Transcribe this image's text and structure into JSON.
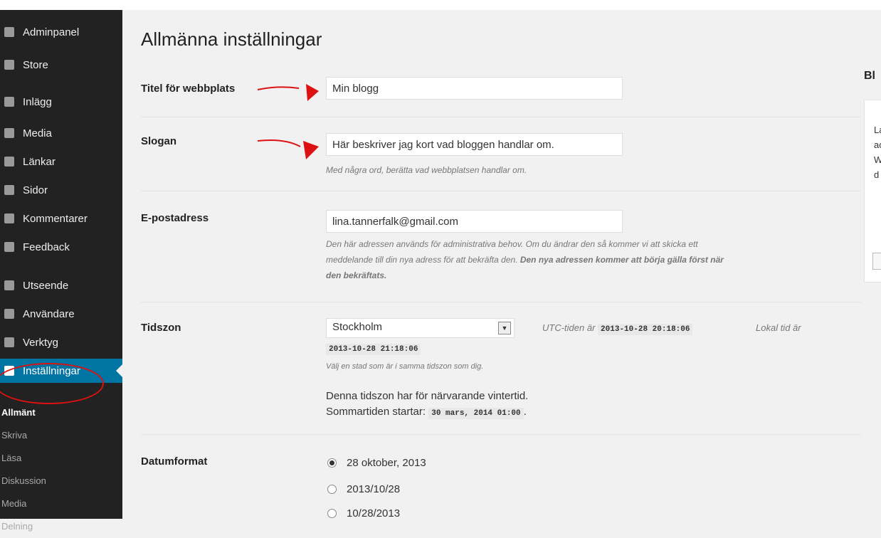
{
  "sidebar": {
    "items": [
      {
        "label": "Adminpanel"
      },
      {
        "label": "Store"
      },
      {
        "label": "Inlägg"
      },
      {
        "label": "Media"
      },
      {
        "label": "Länkar"
      },
      {
        "label": "Sidor"
      },
      {
        "label": "Kommentarer"
      },
      {
        "label": "Feedback"
      },
      {
        "label": "Utseende"
      },
      {
        "label": "Användare"
      },
      {
        "label": "Verktyg"
      },
      {
        "label": "Inställningar"
      }
    ],
    "submenu": [
      "Allmänt",
      "Skriva",
      "Läsa",
      "Diskussion",
      "Media",
      "Delning"
    ]
  },
  "page": {
    "title": "Allmänna inställningar"
  },
  "title_row": {
    "label": "Titel för webbplats",
    "value": "Min blogg"
  },
  "slogan_row": {
    "label": "Slogan",
    "value": "Här beskriver jag kort vad bloggen handlar om.",
    "desc": "Med några ord, berätta vad webbplatsen handlar om."
  },
  "email_row": {
    "label": "E-postadress",
    "value": "lina.tannerfalk@gmail.com",
    "desc_1": "Den här adressen används för administrativa behov. Om du ändrar den så kommer vi att skicka ett",
    "desc_2": "meddelande till din nya adress för att bekräfta den.",
    "desc_bold_1": "Den nya adressen kommer att börja gälla först när",
    "desc_bold_2": "den bekräftats."
  },
  "timezone_row": {
    "label": "Tidszon",
    "selected": "Stockholm",
    "utc_label": "UTC-tiden är",
    "utc_value": "2013-10-28 20:18:06",
    "local_label": "Lokal tid är",
    "local_value": "2013-10-28 21:18:06",
    "desc": "Välj en stad som är i samma tidszon som dig.",
    "dst_note": "Denna tidszon har för närvarande vintertid.",
    "dst_start_label": "Sommartiden startar:",
    "dst_start_value": "30 mars, 2014 01:00"
  },
  "date_row": {
    "label": "Datumformat",
    "options": [
      "28 oktober, 2013",
      "2013/10/28",
      "10/28/2013"
    ],
    "selected_index": 0
  },
  "right_panel": {
    "title": "Bl",
    "lines": [
      "La",
      "ac",
      "W",
      "d"
    ]
  },
  "colors": {
    "sidebar": "#222222",
    "active": "#0074a2",
    "annotation": "#dd1111"
  }
}
